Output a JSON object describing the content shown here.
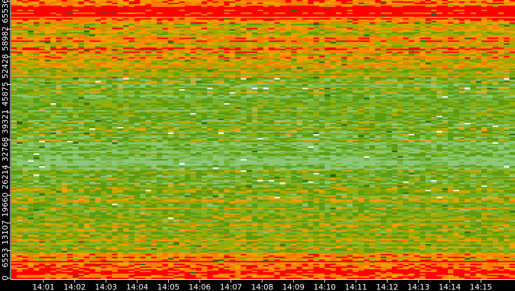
{
  "chart_data": {
    "type": "heatmap",
    "title": "",
    "xlabel": "",
    "ylabel": "",
    "x_tick_labels": [
      "14:01",
      "14:02",
      "14:03",
      "14:04",
      "14:05",
      "14:06",
      "14:07",
      "14:08",
      "14:09",
      "14:10",
      "14:11",
      "14:12",
      "14:13",
      "14:14",
      "14:15"
    ],
    "y_tick_labels": [
      "0",
      "6553",
      "13107",
      "19660",
      "26214",
      "32768",
      "39321",
      "45875",
      "52428",
      "58982",
      "65536"
    ],
    "ylim": [
      0,
      65536
    ],
    "x_range": [
      "14:00",
      "14:15"
    ],
    "grid": false,
    "legend": "none",
    "colormap": [
      "#8cc878",
      "#76b43a",
      "#5e9c10",
      "#9aac00",
      "#f0a000",
      "#ff7a00",
      "#ff0000"
    ],
    "accent_colors": {
      "speck": "#ffffff",
      "dark": "#2e6414",
      "background": "#000000"
    },
    "rows_top_to_bottom_intensity": [
      0.7,
      0.72,
      1,
      1,
      1,
      1,
      0.75,
      0.7,
      0.6,
      0.62,
      0.58,
      0.6,
      0.62,
      0.65,
      0.68,
      0.66,
      0.7,
      0.72,
      0.65,
      0.62,
      0.6,
      0.55,
      0.58,
      0.52,
      0.55,
      0.5,
      0.48,
      0.45,
      0.35,
      0.33,
      0.3,
      0.28,
      0.3,
      0.32,
      0.3,
      0.28,
      0.3,
      0.3,
      0.32,
      0.28,
      0.3,
      0.35,
      0.36,
      0.34,
      0.33,
      0.35,
      0.37,
      0.34,
      0.3,
      0.32,
      0.35,
      0.22,
      0.2,
      0.18,
      0.2,
      0.22,
      0.2,
      0.18,
      0.2,
      0.22,
      0.25,
      0.35,
      0.38,
      0.34,
      0.36,
      0.35,
      0.33,
      0.4,
      0.38,
      0.36,
      0.35,
      0.4,
      0.42,
      0.38,
      0.4,
      0.42,
      0.44,
      0.4,
      0.38,
      0.4,
      0.42,
      0.45,
      0.48,
      0.44,
      0.46,
      0.5,
      0.45,
      0.44,
      0.46,
      0.5,
      0.55,
      0.75,
      0.8,
      0.85,
      0.82,
      0.9,
      0.88,
      0.85,
      0.9,
      0.92
    ],
    "columns": 90
  }
}
